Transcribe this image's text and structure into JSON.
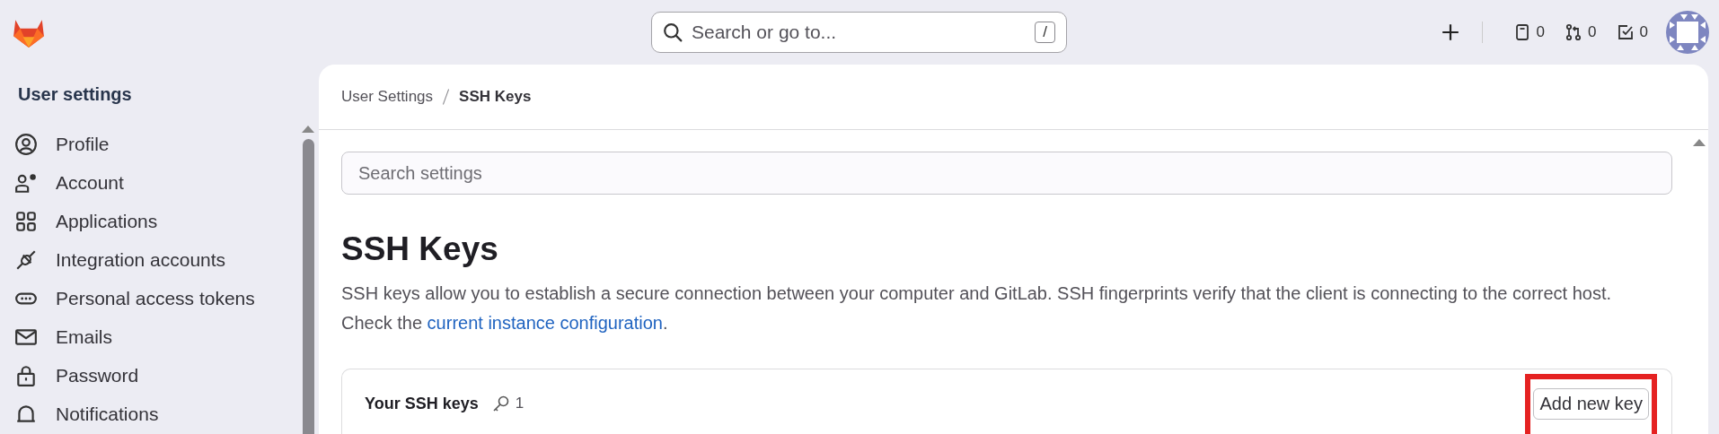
{
  "top_bar": {
    "search": {
      "placeholder": "Search or go to...",
      "shortcut": "/"
    },
    "counters": [
      {
        "count": "0"
      },
      {
        "count": "0"
      },
      {
        "count": "0"
      }
    ]
  },
  "sidebar": {
    "title": "User settings",
    "items": [
      {
        "label": "Profile"
      },
      {
        "label": "Account"
      },
      {
        "label": "Applications"
      },
      {
        "label": "Integration accounts"
      },
      {
        "label": "Personal access tokens"
      },
      {
        "label": "Emails"
      },
      {
        "label": "Password"
      },
      {
        "label": "Notifications"
      }
    ]
  },
  "breadcrumb": [
    {
      "label": "User Settings",
      "selected": false
    },
    {
      "label": "SSH Keys",
      "selected": true
    }
  ],
  "settings_search": {
    "placeholder": "Search settings"
  },
  "heading": "SSH Keys",
  "description": {
    "text": "SSH keys allow you to establish a secure connection between your computer and GitLab. SSH fingerprints verify that the client is connecting to the correct host. Check the ",
    "link": "current instance configuration",
    "after": "."
  },
  "keys_card": {
    "title": "Your SSH keys",
    "count": "1",
    "button": {
      "label": "Add new key",
      "highlighted": true
    }
  }
}
